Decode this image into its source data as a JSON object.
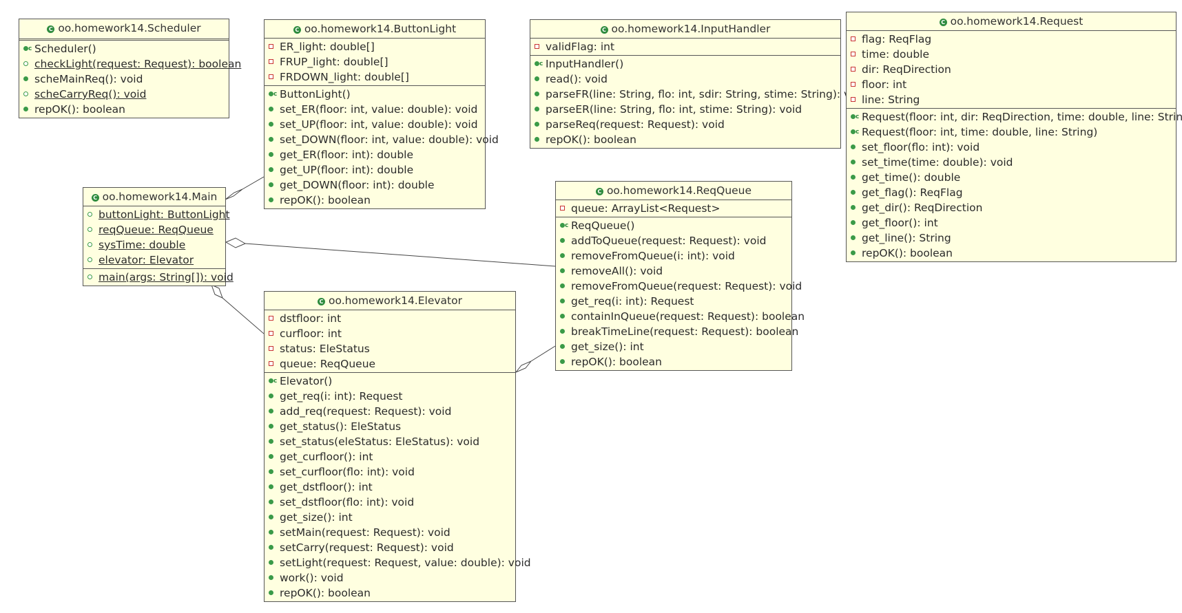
{
  "classes": {
    "scheduler": {
      "title": "oo.homework14.Scheduler",
      "ops": [
        "Scheduler()",
        "checkLight(request: Request): boolean",
        "scheMainReq(): void",
        "scheCarryReq(): void",
        "repOK(): boolean"
      ]
    },
    "buttonlight": {
      "title": "oo.homework14.ButtonLight",
      "attrs": [
        "ER_light: double[]",
        "FRUP_light: double[]",
        "FRDOWN_light: double[]"
      ],
      "ops": [
        "ButtonLight()",
        "set_ER(floor: int, value: double): void",
        "set_UP(floor: int, value: double): void",
        "set_DOWN(floor: int, value: double): void",
        "get_ER(floor: int): double",
        "get_UP(floor: int): double",
        "get_DOWN(floor: int): double",
        "repOK(): boolean"
      ]
    },
    "inputhandler": {
      "title": "oo.homework14.InputHandler",
      "attrs": [
        "validFlag: int"
      ],
      "ops": [
        "InputHandler()",
        "read(): void",
        "parseFR(line: String, flo: int, sdir: String, stime: String): void",
        "parseER(line: String, flo: int, stime: String): void",
        "parseReq(request: Request): void",
        "repOK(): boolean"
      ]
    },
    "request": {
      "title": "oo.homework14.Request",
      "attrs": [
        "flag: ReqFlag",
        "time: double",
        "dir: ReqDirection",
        "floor: int",
        "line: String"
      ],
      "ops": [
        "Request(floor: int, dir: ReqDirection, time: double, line: String)",
        "Request(floor: int, time: double, line: String)",
        "set_floor(flo: int): void",
        "set_time(time: double): void",
        "get_time(): double",
        "get_flag(): ReqFlag",
        "get_dir(): ReqDirection",
        "get_floor(): int",
        "get_line(): String",
        "repOK(): boolean"
      ]
    },
    "main": {
      "title": "oo.homework14.Main",
      "attrs": [
        "buttonLight: ButtonLight",
        "reqQueue: ReqQueue",
        "sysTime: double",
        "elevator: Elevator"
      ],
      "ops": [
        "main(args: String[]): void"
      ]
    },
    "reqqueue": {
      "title": "oo.homework14.ReqQueue",
      "attrs": [
        "queue: ArrayList<Request>"
      ],
      "ops": [
        "ReqQueue()",
        "addToQueue(request: Request): void",
        "removeFromQueue(i: int): void",
        "removeAll(): void",
        "removeFromQueue(request: Request): void",
        "get_req(i: int): Request",
        "containInQueue(request: Request): boolean",
        "breakTimeLine(request: Request): boolean",
        "get_size(): int",
        "repOK(): boolean"
      ]
    },
    "elevator": {
      "title": "oo.homework14.Elevator",
      "attrs": [
        "dstfloor: int",
        "curfloor: int",
        "status: EleStatus",
        "queue: ReqQueue"
      ],
      "ops": [
        "Elevator()",
        "get_req(i: int): Request",
        "add_req(request: Request): void",
        "get_status(): EleStatus",
        "set_status(eleStatus: EleStatus): void",
        "get_curfloor(): int",
        "set_curfloor(flo: int): void",
        "get_dstfloor(): int",
        "set_dstfloor(flo: int): void",
        "get_size(): int",
        "setMain(request: Request): void",
        "setCarry(request: Request): void",
        "setLight(request: Request, value: double): void",
        "work(): void",
        "repOK(): boolean"
      ]
    }
  },
  "icons": {
    "class": "class-icon",
    "private_field": "private-field-icon",
    "public_method": "public-method-icon",
    "constructor": "constructor-icon"
  },
  "colors": {
    "class_fill": "#ffffe0",
    "border": "#555555",
    "public_marker": "#3a9a48",
    "private_marker": "#c83232"
  }
}
